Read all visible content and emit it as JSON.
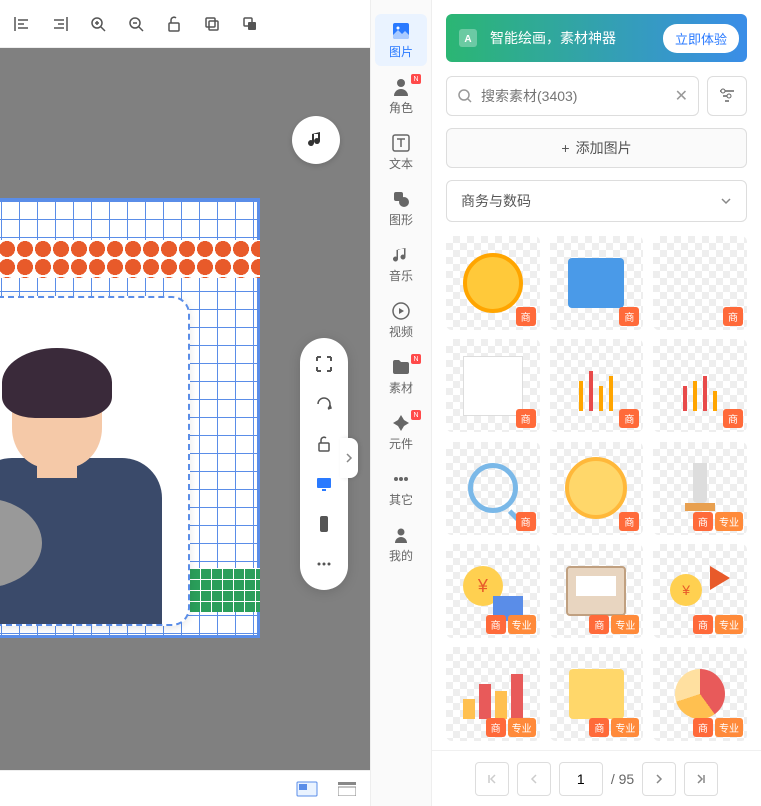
{
  "toolbar_top": {
    "tools": [
      "align-left",
      "align-right",
      "zoom-in",
      "zoom-out",
      "lock",
      "copy",
      "paste"
    ]
  },
  "nav": [
    {
      "label": "图片",
      "active": true
    },
    {
      "label": "角色",
      "badge": true
    },
    {
      "label": "文本"
    },
    {
      "label": "图形"
    },
    {
      "label": "音乐"
    },
    {
      "label": "视频"
    },
    {
      "label": "素材",
      "badge": true
    },
    {
      "label": "元件",
      "badge": true
    },
    {
      "label": "其它"
    },
    {
      "label": "我的"
    }
  ],
  "promo": {
    "text": "智能绘画，素材神器",
    "button": "立即体验"
  },
  "search": {
    "placeholder": "搜索素材(3403)",
    "value": ""
  },
  "add_button": "添加图片",
  "category": {
    "selected": "商务与数码"
  },
  "assets": [
    {
      "name": "gold-coin",
      "badges": [
        "商"
      ]
    },
    {
      "name": "blue-note",
      "badges": [
        "商"
      ]
    },
    {
      "name": "blank-asset",
      "badges": [
        "商"
      ]
    },
    {
      "name": "white-card",
      "badges": [
        "商"
      ]
    },
    {
      "name": "candlestick-1",
      "badges": [
        "商"
      ]
    },
    {
      "name": "candlestick-2",
      "badges": [
        "商"
      ]
    },
    {
      "name": "magnifier",
      "badges": [
        "商"
      ]
    },
    {
      "name": "gold-coin-2",
      "badges": [
        "商"
      ]
    },
    {
      "name": "lab-flask",
      "badges": [
        "商",
        "专业"
      ]
    },
    {
      "name": "money-illus",
      "badges": [
        "商",
        "专业"
      ]
    },
    {
      "name": "computer",
      "badges": [
        "商",
        "专业"
      ]
    },
    {
      "name": "coin-arrow",
      "badges": [
        "商",
        "专业"
      ]
    },
    {
      "name": "bar-chart",
      "badges": [
        "商",
        "专业"
      ]
    },
    {
      "name": "gift-box",
      "badges": [
        "商",
        "专业"
      ]
    },
    {
      "name": "pie-chart",
      "badges": [
        "商",
        "专业"
      ]
    }
  ],
  "badges": {
    "commercial": "商",
    "pro": "专业"
  },
  "pagination": {
    "current": "1",
    "total": "/ 95"
  }
}
